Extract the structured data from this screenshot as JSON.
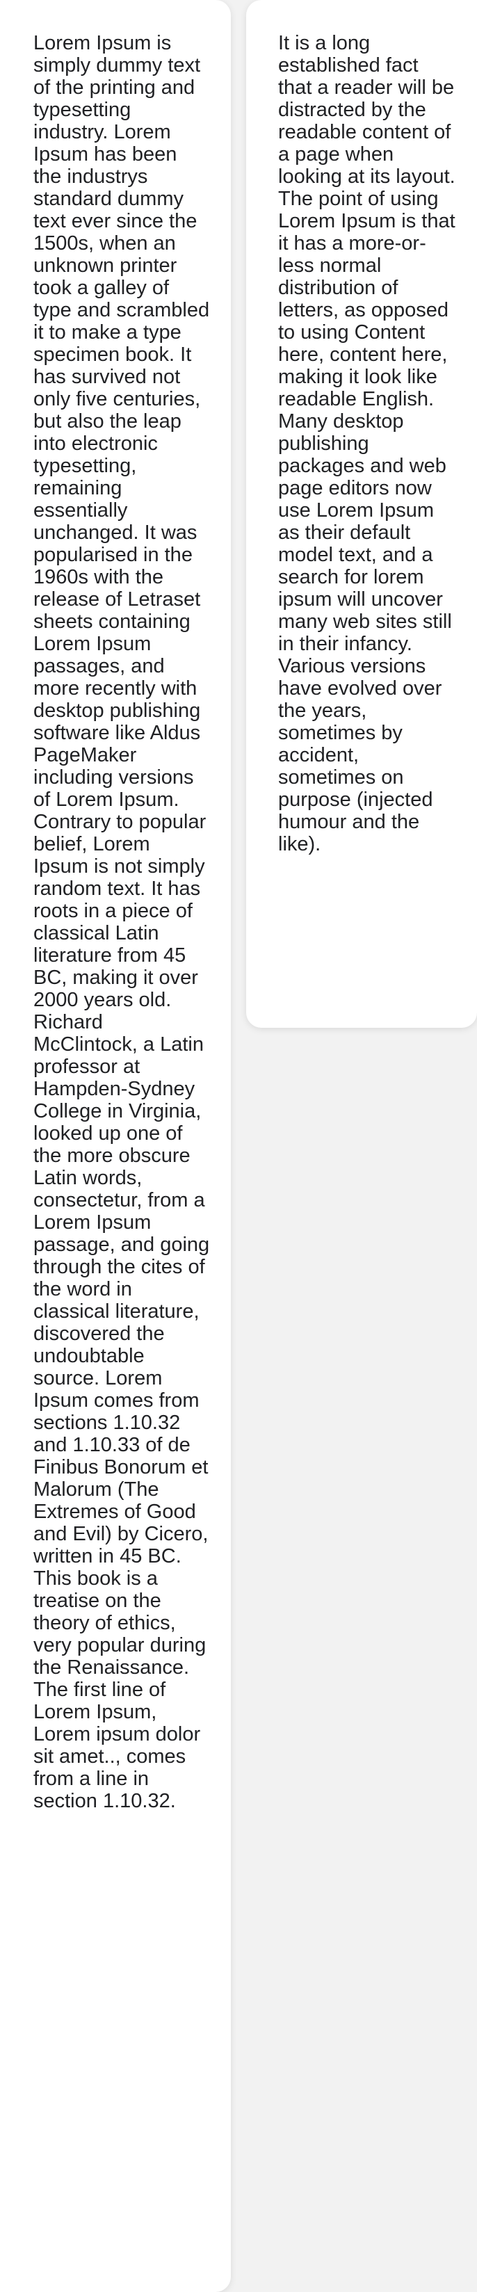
{
  "cards": [
    {
      "text": "Lorem Ipsum is simply dummy text of the printing and typesetting industry. Lorem Ipsum has been the industrys standard dummy text ever since the 1500s, when an unknown printer took a galley of type and scrambled it to make a type specimen book. It has survived not only five centuries, but also the leap into electronic typesetting, remaining essentially unchanged. It was popularised in the 1960s with the release of Letraset sheets containing Lorem Ipsum passages, and more recently with desktop publishing software like Aldus PageMaker including versions of Lorem Ipsum. Contrary to popular belief, Lorem Ipsum is not simply random text. It has roots in a piece of classical Latin literature from 45 BC, making it over 2000 years old. Richard McClintock, a Latin professor at Hampden-Sydney College in Virginia, looked up one of the more obscure Latin words, consectetur, from a Lorem Ipsum passage, and going through the cites of the word in classical literature, discovered the undoubtable source. Lorem Ipsum comes from sections 1.10.32 and 1.10.33 of de Finibus Bonorum et Malorum (The Extremes of Good and Evil) by Cicero, written in 45 BC. This book is a treatise on the theory of ethics, very popular during the Renaissance. The first line of Lorem Ipsum, Lorem ipsum dolor sit amet.., comes from a line in section 1.10.32."
    },
    {
      "text": "It is a long established fact that a reader will be distracted by the readable content of a page when looking at its layout. The point of using Lorem Ipsum is that it has a more-or-less normal distribution of letters, as opposed to using Content here, content here, making it look like readable English. Many desktop publishing packages and web page editors now use Lorem Ipsum as their default model text, and a search for lorem ipsum will uncover many web sites still in their infancy. Various versions have evolved over the years, sometimes by accident, sometimes on purpose (injected humour and the like)."
    }
  ]
}
